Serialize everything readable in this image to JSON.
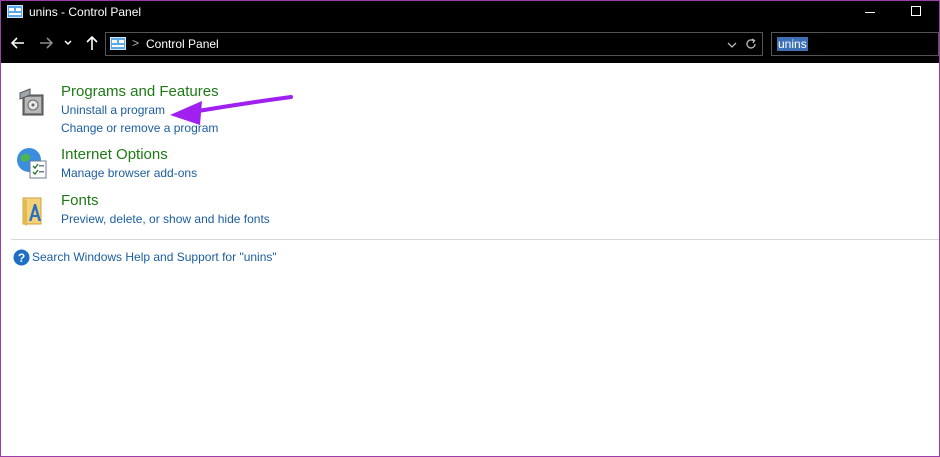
{
  "window": {
    "title": "unins - Control Panel",
    "border_color": "#9b3fa8"
  },
  "titlebar": {
    "icon": "control-panel-icon",
    "minimize_icon": "minimize-icon",
    "maximize_icon": "maximize-icon"
  },
  "nav": {
    "back_icon": "back-arrow-icon",
    "forward_icon": "forward-arrow-icon",
    "recent_icon": "chevron-down-icon",
    "up_icon": "up-arrow-icon"
  },
  "address": {
    "icon": "control-panel-icon",
    "separator": ">",
    "path": "Control Panel",
    "dropdown_icon": "chevron-down-icon",
    "refresh_icon": "refresh-icon"
  },
  "search": {
    "value": "unins"
  },
  "results": [
    {
      "icon": "programs-features-icon",
      "title": "Programs and Features",
      "links": [
        "Uninstall a program",
        "Change or remove a program"
      ]
    },
    {
      "icon": "internet-options-icon",
      "title": "Internet Options",
      "links": [
        "Manage browser add-ons"
      ]
    },
    {
      "icon": "fonts-folder-icon",
      "title": "Fonts",
      "links": [
        "Preview, delete, or show and hide fonts"
      ]
    }
  ],
  "help": {
    "icon": "help-icon",
    "text": "Search Windows Help and Support for \"unins\""
  },
  "annotation": {
    "icon": "pointer-arrow-icon",
    "color": "#a020f0"
  },
  "colors": {
    "title_green": "#1e7a16",
    "link_blue": "#1c5ea0",
    "chrome_black": "#000000",
    "search_highlight": "#3d6fb5"
  }
}
